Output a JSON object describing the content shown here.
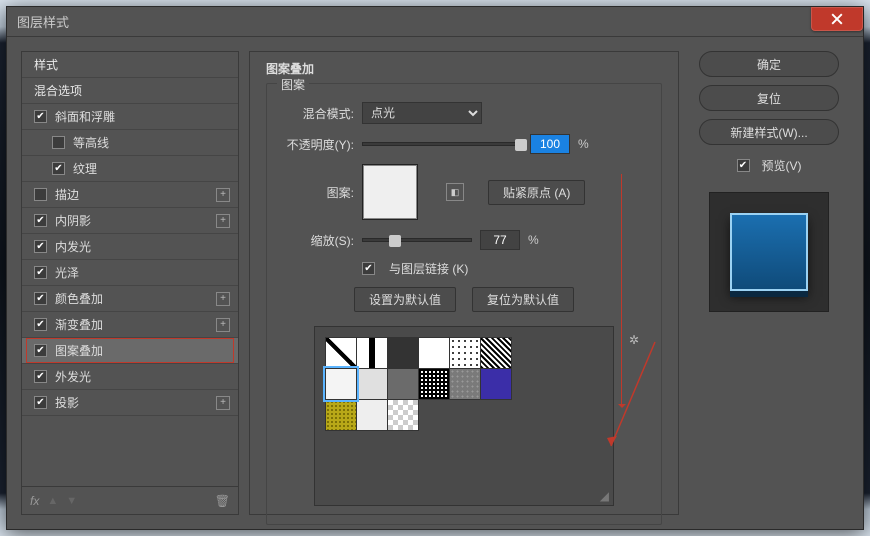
{
  "window_title": "图层样式",
  "close": "x",
  "sidebar": {
    "header_style": "样式",
    "header_blend": "混合选项",
    "items": [
      {
        "label": "斜面和浮雕",
        "checked": true,
        "plus": false
      },
      {
        "label": "等高线",
        "checked": false,
        "plus": false,
        "indent": true
      },
      {
        "label": "纹理",
        "checked": true,
        "plus": false,
        "indent": true
      },
      {
        "label": "描边",
        "checked": false,
        "plus": true
      },
      {
        "label": "内阴影",
        "checked": true,
        "plus": true
      },
      {
        "label": "内发光",
        "checked": true,
        "plus": false
      },
      {
        "label": "光泽",
        "checked": true,
        "plus": false
      },
      {
        "label": "颜色叠加",
        "checked": true,
        "plus": true
      },
      {
        "label": "渐变叠加",
        "checked": true,
        "plus": true
      },
      {
        "label": "图案叠加",
        "checked": true,
        "plus": false,
        "selected": true,
        "highlight_box": true
      },
      {
        "label": "外发光",
        "checked": true,
        "plus": false
      },
      {
        "label": "投影",
        "checked": true,
        "plus": true
      }
    ],
    "footer_fx": "fx"
  },
  "panel": {
    "title": "图案叠加",
    "legend": "图案",
    "blend_label": "混合模式:",
    "blend_value": "点光",
    "opacity_label": "不透明度(Y):",
    "opacity_value": "100",
    "percent": "%",
    "pattern_label": "图案:",
    "snap_button": "贴紧原点 (A)",
    "scale_label": "缩放(S):",
    "scale_value": "77",
    "link_label": "与图层链接 (K)",
    "set_default": "设置为默认值",
    "reset_default": "复位为默认值"
  },
  "right": {
    "ok": "确定",
    "reset": "复位",
    "new_style": "新建样式(W)...",
    "preview_label": "预览(V)"
  }
}
